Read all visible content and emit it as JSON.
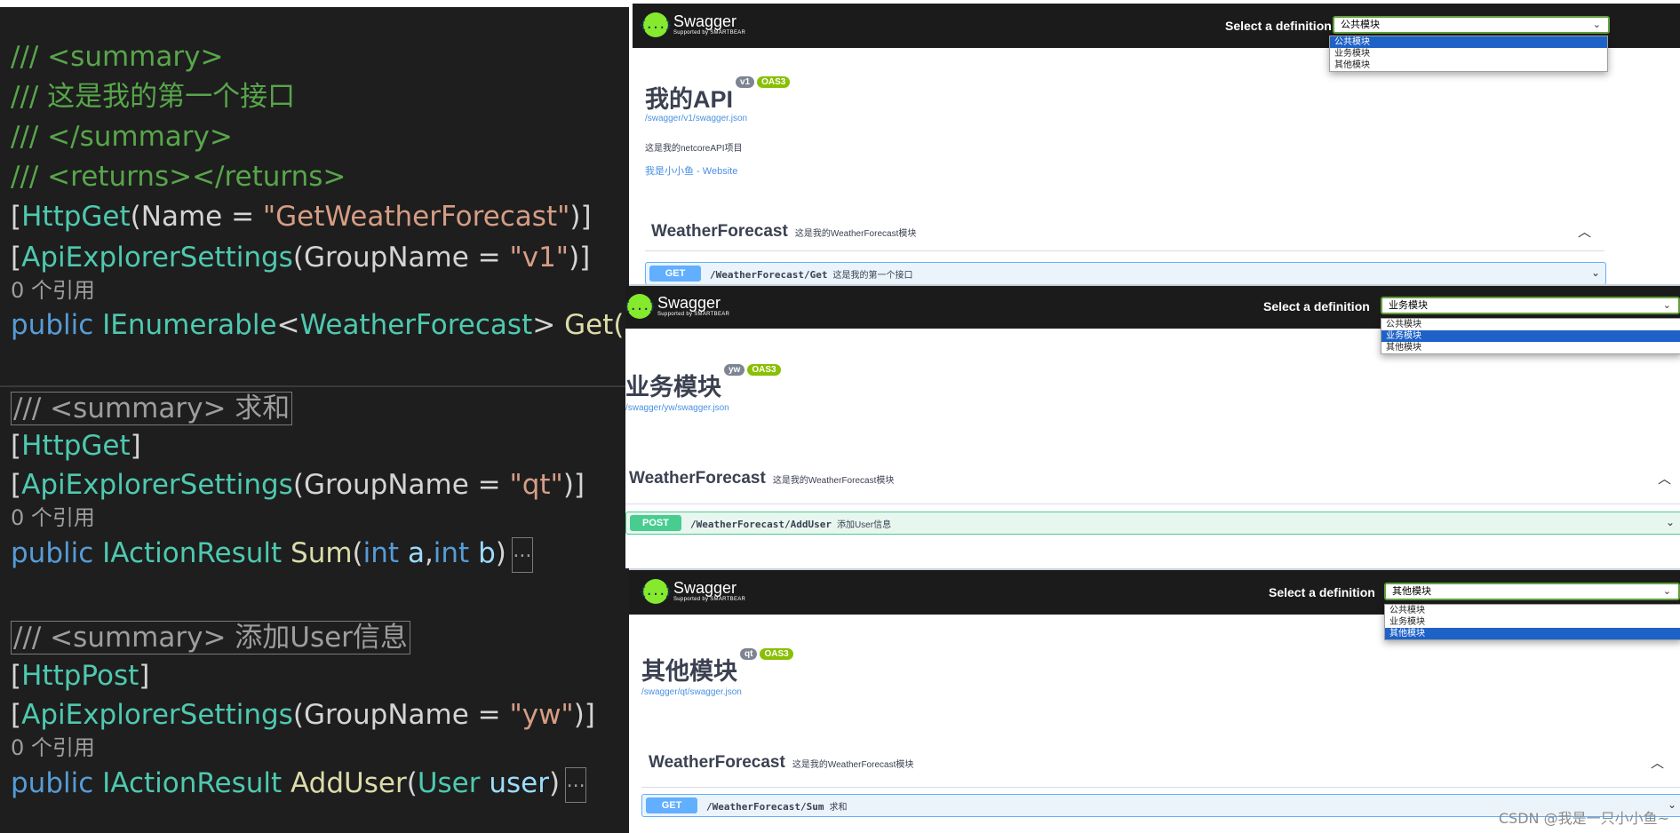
{
  "editor": {
    "block1": {
      "summary_open": "/// <summary>",
      "summary_text": "/// 这是我的第一个接口",
      "summary_close": "/// </summary>",
      "returns": "/// <returns></returns>",
      "attr1": {
        "name": "HttpGet",
        "param": "Name = ",
        "value": "\"GetWeatherForecast\""
      },
      "attr2": {
        "name": "ApiExplorerSettings",
        "param": "GroupName = ",
        "value": "\"v1\""
      },
      "refs": "0 个引用",
      "sig": {
        "kw": "public",
        "type1": "IEnumerable",
        "type2": "WeatherForecast",
        "method": "Get()"
      }
    },
    "block2": {
      "summary_collapsed": "/// <summary> 求和",
      "attr1": {
        "name": "HttpGet"
      },
      "attr2": {
        "name": "ApiExplorerSettings",
        "param": "GroupName = ",
        "value": "\"qt\""
      },
      "refs": "0 个引用",
      "sig": {
        "kw": "public",
        "type": "IActionResult",
        "method": "Sum",
        "p1_type": "int",
        "p1_name": "a",
        "p2_type": "int",
        "p2_name": "b",
        "ellipsis": "..."
      }
    },
    "block3": {
      "summary_collapsed": "/// <summary> 添加User信息",
      "attr1": {
        "name": "HttpPost"
      },
      "attr2": {
        "name": "ApiExplorerSettings",
        "param": "GroupName = ",
        "value": "\"yw\""
      },
      "refs": "0 个引用",
      "sig": {
        "kw": "public",
        "type": "IActionResult",
        "method": "AddUser",
        "p_type": "User",
        "p_name": "user",
        "ellipsis": "..."
      }
    }
  },
  "swagger": {
    "logo_title": "Swagger",
    "logo_sub": "Supported by SMARTBEAR",
    "logo_glyph": "{...}",
    "select_label": "Select a definition",
    "options": [
      "公共模块",
      "业务模块",
      "其他模块"
    ],
    "panels": [
      {
        "selected": "公共模块",
        "title": "我的API",
        "version": "v1",
        "oas": "OAS3",
        "url": "/swagger/v1/swagger.json",
        "description": "这是我的netcoreAPI项目",
        "contact": "我是小小鱼 - Website",
        "tag": "WeatherForecast",
        "tag_desc": "这是我的WeatherForecast模块",
        "op": {
          "method": "GET",
          "path": "/WeatherForecast/Get",
          "summary": "这是我的第一个接口"
        }
      },
      {
        "selected": "业务模块",
        "title": "业务模块",
        "version": "yw",
        "oas": "OAS3",
        "url": "/swagger/yw/swagger.json",
        "tag": "WeatherForecast",
        "tag_desc": "这是我的WeatherForecast模块",
        "op": {
          "method": "POST",
          "path": "/WeatherForecast/AddUser",
          "summary": "添加User信息"
        }
      },
      {
        "selected": "其他模块",
        "title": "其他模块",
        "version": "qt",
        "oas": "OAS3",
        "url": "/swagger/qt/swagger.json",
        "tag": "WeatherForecast",
        "tag_desc": "这是我的WeatherForecast模块",
        "op": {
          "method": "GET",
          "path": "/WeatherForecast/Sum",
          "summary": "求和"
        }
      }
    ]
  },
  "watermark": "CSDN @我是一只小小鱼~"
}
